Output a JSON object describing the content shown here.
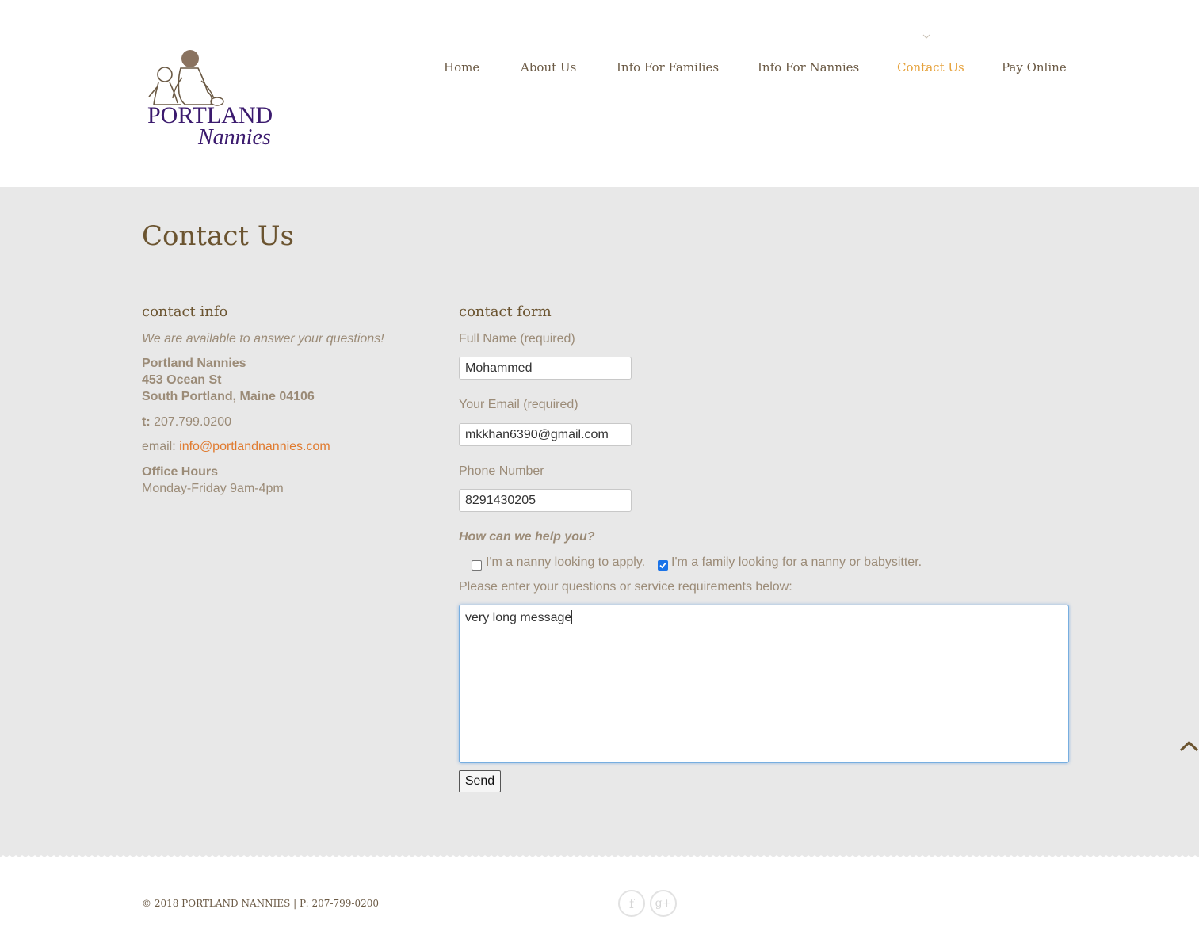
{
  "brand": {
    "logo_line1": "PORTLAND",
    "logo_line2": "Nannies"
  },
  "nav": {
    "items": [
      {
        "label": "Home",
        "active": false
      },
      {
        "label": "About Us",
        "active": false
      },
      {
        "label": "Info For Families",
        "active": false
      },
      {
        "label": "Info For Nannies",
        "active": false
      },
      {
        "label": "Contact Us",
        "active": true
      },
      {
        "label": "Pay Online",
        "active": false
      }
    ]
  },
  "page": {
    "title": "Contact Us"
  },
  "contact_info": {
    "heading": "contact info",
    "tagline": "We are available to answer your questions!",
    "company": "Portland Nannies",
    "street": "453 Ocean St",
    "city": "South Portland, Maine 04106",
    "phone_label": "t:",
    "phone": "207.799.0200",
    "email_label": "email:",
    "email": "info@portlandnannies.com",
    "hours_heading": "Office Hours",
    "hours": "Monday-Friday 9am-4pm"
  },
  "contact_form": {
    "heading": "contact form",
    "full_name": {
      "label": "Full Name (required)",
      "value": "Mohammed"
    },
    "email": {
      "label": "Your Email (required)",
      "value": "mkkhan6390@gmail.com"
    },
    "phone": {
      "label": "Phone Number",
      "value": "8291430205"
    },
    "help_question": "How can we help you?",
    "options": [
      {
        "label": "I'm a nanny looking to apply.",
        "checked": false
      },
      {
        "label": "I'm a family looking for a nanny or babysitter.",
        "checked": true
      }
    ],
    "message_label": "Please enter your questions or service requirements below:",
    "message_value": "very long message",
    "send_label": "Send"
  },
  "footer": {
    "copyright": "© 2018 PORTLAND NANNIES | P: 207-799-0200",
    "social_icons": [
      "facebook-icon",
      "google-plus-icon"
    ],
    "facebook_glyph": "f",
    "googleplus_glyph": "g+"
  },
  "colors": {
    "accent": "#e6a23c",
    "heading": "#6b5430",
    "text": "#9b8b77",
    "link": "#e07a2e",
    "main_bg": "#e8e8e8",
    "logo_text": "#3b1a6e"
  }
}
